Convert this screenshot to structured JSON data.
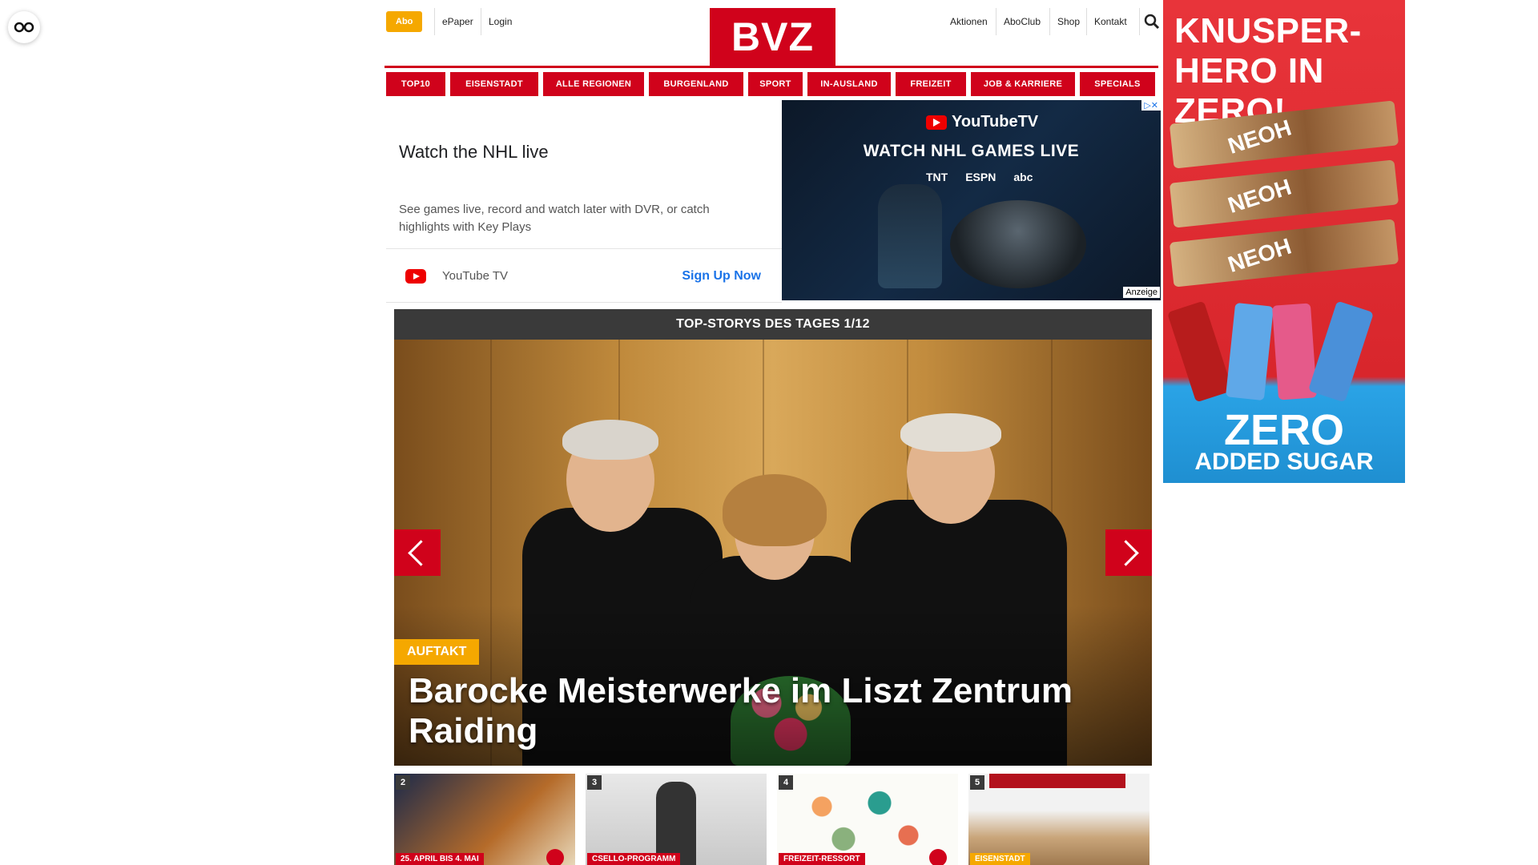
{
  "floating": {
    "icon": "glasses-icon"
  },
  "header": {
    "abo": "Abo",
    "links_left": [
      "ePaper",
      "Login"
    ],
    "logo": "BVZ",
    "links_right": [
      "Aktionen",
      "AboClub",
      "Shop",
      "Kontakt"
    ],
    "search_icon": "search-icon"
  },
  "nav": [
    "TOP10",
    "EISENSTADT",
    "ALLE REGIONEN",
    "BURGENLAND",
    "SPORT",
    "IN-AUSLAND",
    "FREIZEIT",
    "JOB & KARRIERE",
    "SPECIALS"
  ],
  "ad": {
    "title": "Watch the NHL live",
    "description": "See games live, record and watch later with DVR, or catch highlights with Key Plays",
    "brand": "YouTube TV",
    "cta": "Sign Up Now",
    "image_brand": "YouTubeTV",
    "image_headline": "WATCH NHL GAMES LIVE",
    "networks": [
      "TNT",
      "ESPN",
      "abc"
    ],
    "badge": "Anzeige",
    "close": "▷✕"
  },
  "sky": {
    "title": "KNUSPER-HERO IN ZERO!",
    "bars": [
      "NEOH",
      "NEOH",
      "NEOH"
    ],
    "zero": "ZERO",
    "sub": "ADDED SUGAR"
  },
  "stories": {
    "header": "TOP-STORYS DES TAGES 1/12",
    "kicker": "AUFTAKT",
    "title": "Barocke Meisterwerke im Liszt Zentrum Raiding"
  },
  "thumbs": [
    {
      "num": "2",
      "label": "25. APRIL BIS 4. MAI"
    },
    {
      "num": "3",
      "label": "CSELLO-PROGRAMM"
    },
    {
      "num": "4",
      "label": "FREIZEIT-RESSORT"
    },
    {
      "num": "5",
      "label": "EISENSTADT"
    }
  ],
  "colors": {
    "brand_red": "#d0021b",
    "accent_yellow": "#f5a800"
  }
}
